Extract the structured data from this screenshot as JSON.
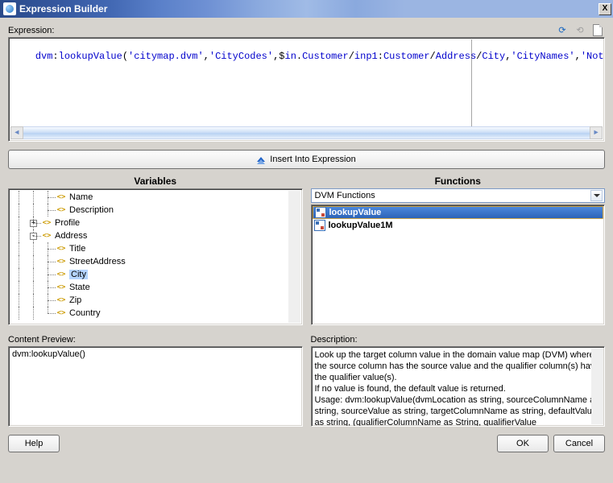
{
  "window": {
    "title": "Expression Builder",
    "close_label": "X"
  },
  "expression": {
    "label": "Expression:",
    "text": "dvm:lookupValue('citymap.dvm','CityCodes',$in.Customer/inp1:Customer/Address/City,'CityNames','NotFound')"
  },
  "toolbar": {
    "refresh": "refresh",
    "repeat": "repeat",
    "newdoc": "new"
  },
  "insert_button": {
    "label": "Insert Into Expression"
  },
  "columns": {
    "variables": "Variables",
    "functions": "Functions"
  },
  "tree": {
    "items": [
      {
        "label": "Name",
        "depth": 3,
        "expander": null
      },
      {
        "label": "Description",
        "depth": 3,
        "expander": null
      },
      {
        "label": "Profile",
        "depth": 2,
        "expander": "+"
      },
      {
        "label": "Address",
        "depth": 2,
        "expander": "-"
      },
      {
        "label": "Title",
        "depth": 3,
        "expander": null
      },
      {
        "label": "StreetAddress",
        "depth": 3,
        "expander": null
      },
      {
        "label": "City",
        "depth": 3,
        "expander": null,
        "selected": true
      },
      {
        "label": "State",
        "depth": 3,
        "expander": null
      },
      {
        "label": "Zip",
        "depth": 3,
        "expander": null
      },
      {
        "label": "Country",
        "depth": 3,
        "expander": null,
        "last": true
      }
    ]
  },
  "functions": {
    "dropdown": "DVM Functions",
    "items": [
      {
        "label": "lookupValue",
        "selected": true
      },
      {
        "label": "lookupValue1M",
        "selected": false
      }
    ]
  },
  "preview": {
    "label": "Content Preview:",
    "text": "dvm:lookupValue()"
  },
  "description": {
    "label": "Description:",
    "text": "Look up the target column value in the domain value map (DVM) where the source column has the source value and the qualifier column(s) have the qualifier value(s).\nIf no value is found, the default value is returned.\nUsage: dvm:lookupValue(dvmLocation as string, sourceColumnName as string, sourceValue as string, targetColumnName as string, defaultValue as string, (qualifierColumnName as String, qualifierValue"
  },
  "footer": {
    "help": "Help",
    "ok": "OK",
    "cancel": "Cancel"
  }
}
